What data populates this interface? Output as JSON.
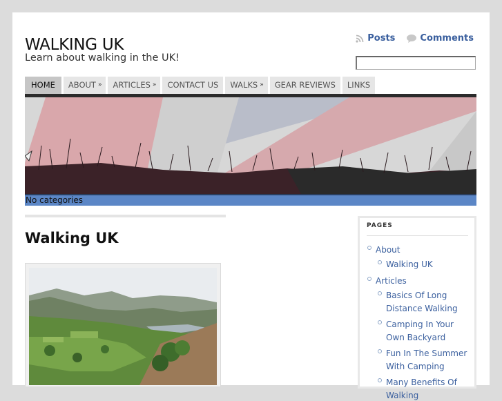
{
  "site": {
    "title": "WALKING UK",
    "description": "Learn about walking in the UK!"
  },
  "feeds": {
    "posts_label": "Posts",
    "comments_label": "Comments",
    "posts_icon": "rss-icon",
    "comments_icon": "speech-bubble-icon"
  },
  "search": {
    "value": "",
    "placeholder": ""
  },
  "nav": {
    "items": [
      {
        "label": "HOME",
        "active": true,
        "dropdown": false
      },
      {
        "label": "ABOUT",
        "active": false,
        "dropdown": true
      },
      {
        "label": "ARTICLES",
        "active": false,
        "dropdown": true
      },
      {
        "label": "CONTACT US",
        "active": false,
        "dropdown": false
      },
      {
        "label": "WALKS",
        "active": false,
        "dropdown": true
      },
      {
        "label": "GEAR REVIEWS",
        "active": false,
        "dropdown": false
      },
      {
        "label": "LINKS",
        "active": false,
        "dropdown": false
      }
    ],
    "dropdown_glyph": "»"
  },
  "header": {
    "image": "union-jack-grass-banner"
  },
  "categories_text": "No categories",
  "post": {
    "title": "Walking UK",
    "image": "lake-district-valley-photo"
  },
  "sidebar": {
    "heading": "PAGES",
    "items": [
      {
        "label": "About",
        "children": [
          {
            "label": "Walking UK"
          }
        ]
      },
      {
        "label": "Articles",
        "children": [
          {
            "label": "Basics Of Long Distance Walking"
          },
          {
            "label": "Camping In Your Own Backyard"
          },
          {
            "label": "Fun In The Summer With Camping"
          },
          {
            "label": "Many Benefits Of Walking"
          }
        ]
      }
    ]
  },
  "colors": {
    "link": "#3a5f9e",
    "category_bar": "#5b86c6",
    "nav_bg": "#e6e6e6",
    "nav_active_bg": "#c6c6c6",
    "page_bg": "#dcdcdc"
  }
}
